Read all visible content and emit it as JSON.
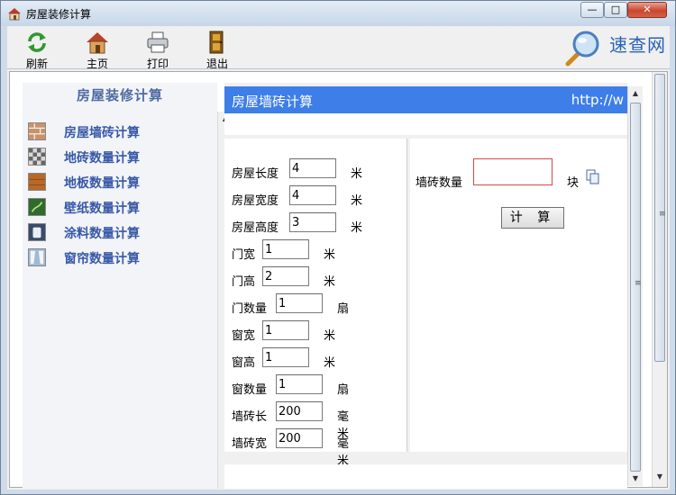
{
  "window": {
    "title": "房屋装修计算",
    "minimize_label": "—",
    "maximize_label": "□",
    "close_label": "✕"
  },
  "toolbar": {
    "refresh_label": "刷新",
    "home_label": "主页",
    "print_label": "打印",
    "exit_label": "退出",
    "logo_text": "速查网"
  },
  "sidebar": {
    "title": "房屋装修计算",
    "items": [
      {
        "label": "房屋墙砖计算",
        "icon": "wall-brick-icon"
      },
      {
        "label": "地砖数量计算",
        "icon": "floor-tile-icon"
      },
      {
        "label": "地板数量计算",
        "icon": "wood-floor-icon"
      },
      {
        "label": "壁纸数量计算",
        "icon": "wallpaper-icon"
      },
      {
        "label": "涂料数量计算",
        "icon": "paint-icon"
      },
      {
        "label": "窗帘数量计算",
        "icon": "curtain-icon"
      }
    ]
  },
  "panel": {
    "title": "房屋墙砖计算",
    "url_text": "http://w"
  },
  "form": {
    "length": {
      "label": "房屋长度",
      "value": "4",
      "unit": "米"
    },
    "width": {
      "label": "房屋宽度",
      "value": "4",
      "unit": "米"
    },
    "height": {
      "label": "房屋高度",
      "value": "3",
      "unit": "米"
    },
    "door_width": {
      "label": "门宽",
      "value": "1",
      "unit": "米"
    },
    "door_height": {
      "label": "门高",
      "value": "2",
      "unit": "米"
    },
    "door_count": {
      "label": "门数量",
      "value": "1",
      "unit": "扇"
    },
    "window_width": {
      "label": "窗宽",
      "value": "1",
      "unit": "米"
    },
    "window_height": {
      "label": "窗高",
      "value": "1",
      "unit": "米"
    },
    "window_count": {
      "label": "窗数量",
      "value": "1",
      "unit": "扇"
    },
    "tile_length": {
      "label": "墙砖长",
      "value": "200",
      "unit": "毫米"
    },
    "tile_width": {
      "label": "墙砖宽",
      "value": "200",
      "unit": "毫米"
    }
  },
  "result": {
    "label": "墙砖数量",
    "value": "",
    "unit": "块",
    "calc_button": "计 算"
  },
  "colors": {
    "header_blue": "#3e7ee8",
    "nav_text": "#3858a8",
    "result_border": "#d84545"
  }
}
